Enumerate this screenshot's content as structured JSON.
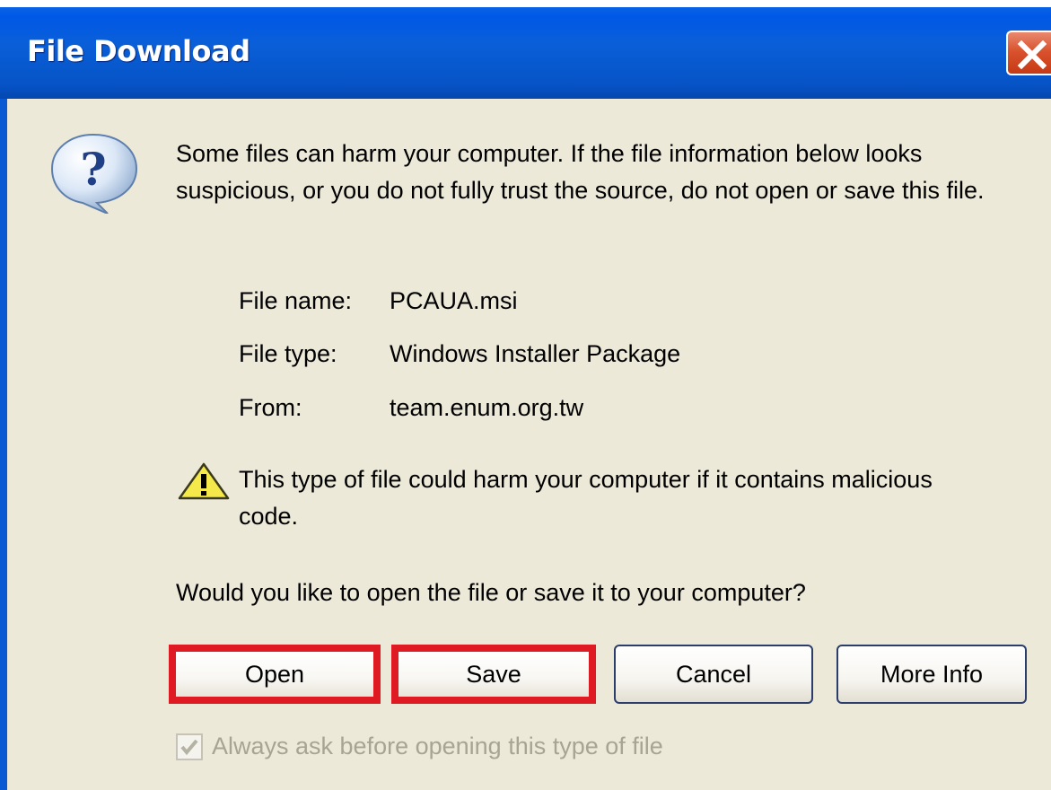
{
  "dialog": {
    "title": "File Download",
    "close_icon": "close-icon",
    "message": "Some files can harm your computer. If the file information below looks suspicious, or you do not fully trust the source, do not open or save this file.",
    "file_info": [
      {
        "label": "File name:",
        "value": "PCAUA.msi"
      },
      {
        "label": "File type:",
        "value": "Windows Installer Package"
      },
      {
        "label": "From:",
        "value": "team.enum.org.tw"
      }
    ],
    "warning": "This type of file could harm your computer if it contains malicious code.",
    "question": "Would you like to open the file or save it to your computer?",
    "buttons": {
      "open": "Open",
      "save": "Save",
      "cancel": "Cancel",
      "more_info": "More Info"
    },
    "checkbox": {
      "label": "Always ask before opening this type of file",
      "checked": true
    }
  },
  "colors": {
    "titlebar": "#0a5fd8",
    "dialog_bg": "#ece9d8",
    "highlight": "#e01a22",
    "close_button": "#d9532e"
  },
  "icons": {
    "question": "question-icon",
    "warning": "warning-icon"
  }
}
